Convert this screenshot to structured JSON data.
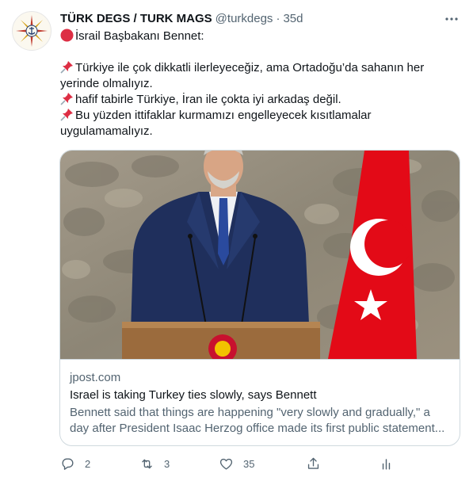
{
  "tweet": {
    "author_name": "TÜRK DEGS / TURK MAGS",
    "handle": "@turkdegs",
    "separator": "·",
    "time": "35d",
    "lines": {
      "l1": "İsrail Başbakanı Bennet:",
      "l2": "Türkiye ile çok dikkatli ilerleyeceğiz, ama Ortadoğu’da sahanın her",
      "l3": "yerinde olmalıyız.",
      "l4": "hafif tabirle Türkiye, İran ile çokta iyi arkadaş değil.",
      "l5": "Bu yüzden ittifaklar kurmamızı engelleyecek kısıtlamalar",
      "l6": "uygulamamalıyız."
    },
    "emoji": {
      "circle": "red-circle-icon",
      "pin": "pushpin-icon"
    }
  },
  "card": {
    "domain": "jpost.com",
    "title": "Israel is taking Turkey ties slowly, says Bennett",
    "description_line1": "Bennett said that things are happening \"very slowly and gradually,\" a",
    "description_line2": "day after President Isaac Herzog office made its first public statement..."
  },
  "actions": {
    "reply_count": "2",
    "retweet_count": "3",
    "like_count": "35"
  },
  "colors": {
    "text": "#0f1419",
    "secondary": "#536471",
    "border": "#cfd9de",
    "flag_red": "#e30a17"
  }
}
